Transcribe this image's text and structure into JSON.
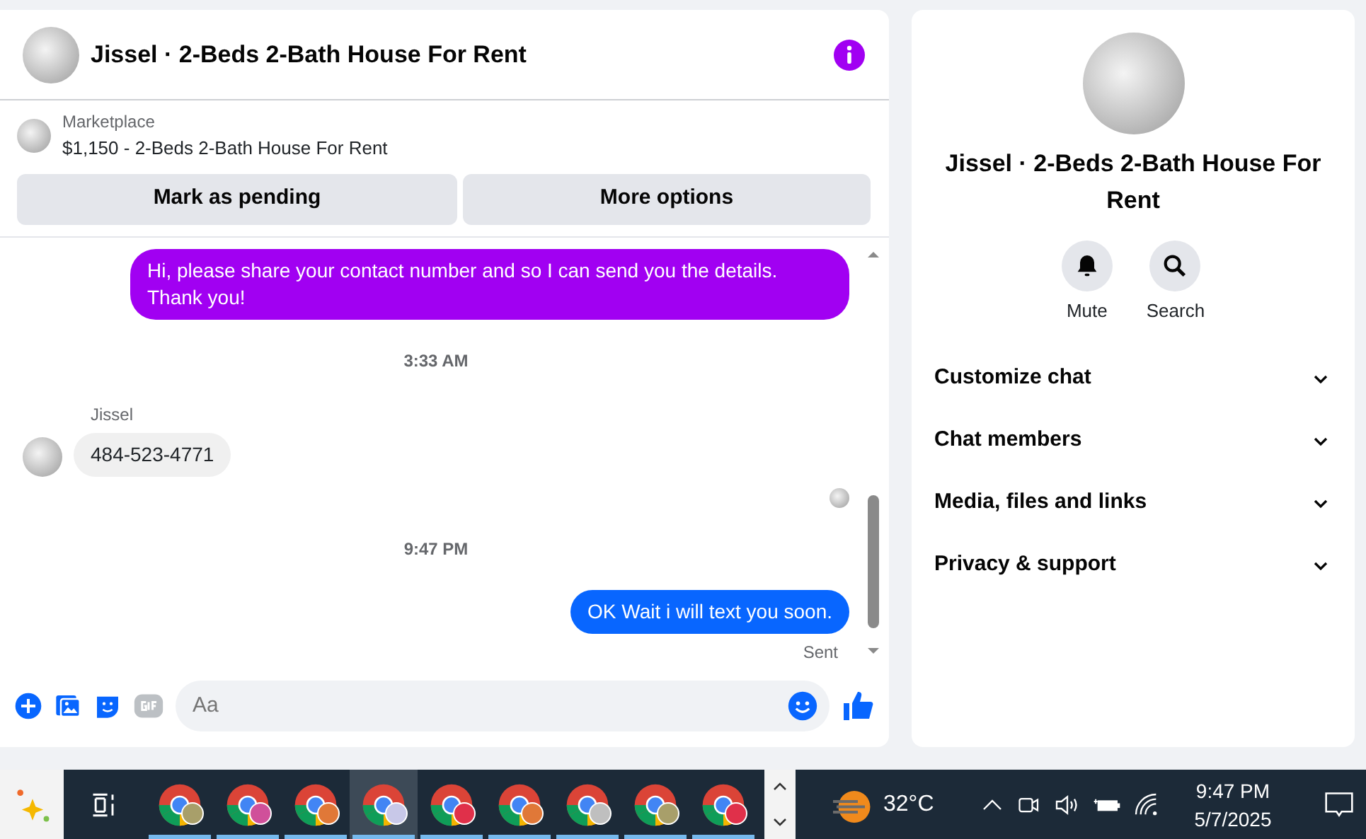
{
  "chat": {
    "title": "Jissel · 2-Beds 2-Bath House For Rent",
    "listing": {
      "source": "Marketplace",
      "title": "$1,150 - 2-Beds 2-Bath House For Rent"
    },
    "actions": [
      "Mark as pending",
      "More options"
    ],
    "messages": [
      {
        "kind": "outgoing",
        "text": "Hi, please share your contact number and so I can send you the details. Thank you!",
        "color": "#a100f2"
      },
      {
        "kind": "timestamp",
        "text": "3:33 AM"
      },
      {
        "kind": "sender",
        "text": "Jissel"
      },
      {
        "kind": "incoming",
        "text": "484-523-4771"
      },
      {
        "kind": "seen"
      },
      {
        "kind": "timestamp",
        "text": "9:47 PM"
      },
      {
        "kind": "outgoing",
        "text": "OK Wait i will text you soon.",
        "color": "#0866ff"
      },
      {
        "kind": "status",
        "text": "Sent"
      }
    ],
    "composer": {
      "placeholder": "Aa"
    }
  },
  "details": {
    "title": "Jissel · 2-Beds 2-Bath House For Rent",
    "actions": [
      {
        "kind": "bell",
        "label": "Mute"
      },
      {
        "kind": "search",
        "label": "Search"
      }
    ],
    "sections": [
      {
        "label": "Customize chat",
        "expanded": false
      },
      {
        "label": "Chat members",
        "expanded": false
      },
      {
        "label": "Media, files and links",
        "expanded": false
      },
      {
        "label": "Privacy & support",
        "expanded": false
      }
    ]
  },
  "taskbar": {
    "apps": [
      {
        "color": "#a89f6a",
        "selected": false
      },
      {
        "color": "#d0509a",
        "selected": false
      },
      {
        "color": "#e07838",
        "selected": false
      },
      {
        "color": "#c8c8e8",
        "selected": true
      },
      {
        "color": "#e0304a",
        "selected": false
      },
      {
        "color": "#e07838",
        "selected": false
      },
      {
        "color": "#bfbfbf",
        "selected": false
      },
      {
        "color": "#a89f6a",
        "selected": false
      },
      {
        "color": "#e0304a",
        "selected": false
      }
    ],
    "temperature": "32°C",
    "time": "9:47 PM",
    "date": "5/7/2025"
  }
}
